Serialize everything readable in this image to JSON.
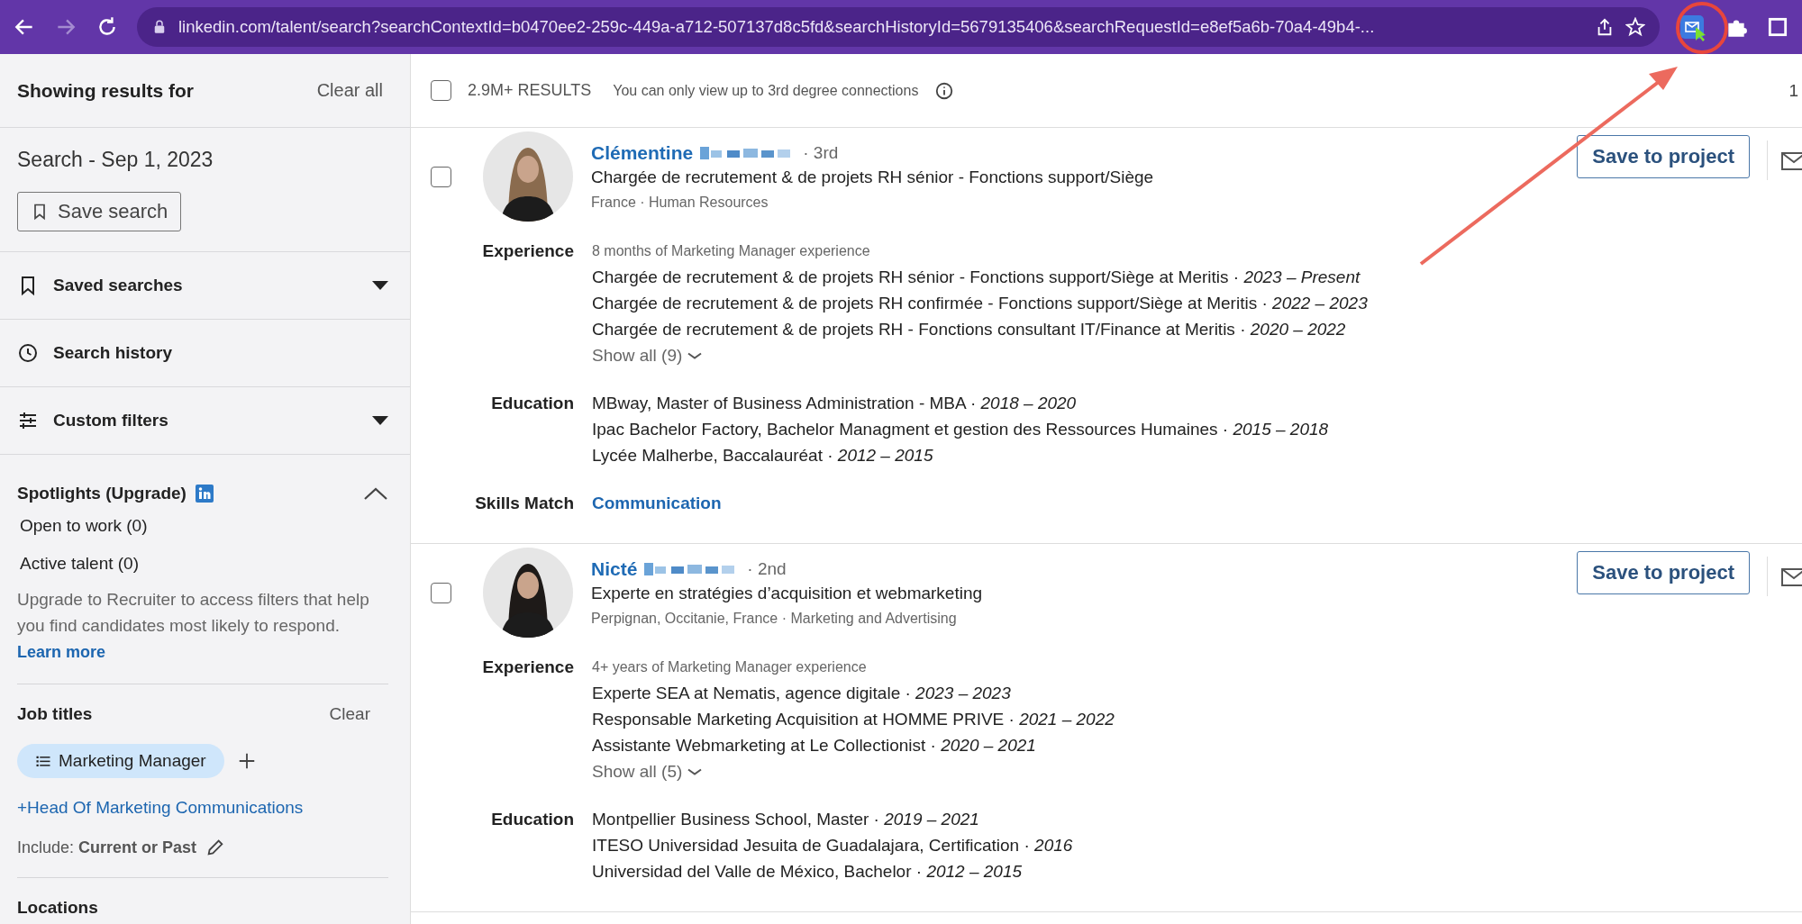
{
  "browser": {
    "url": "linkedin.com/talent/search?searchContextId=b0470ee2-259c-449a-a712-507137d8c5fd&searchHistoryId=5679135406&searchRequestId=e8ef5a6b-70a4-49b4-..."
  },
  "sidebar": {
    "title": "Showing results for",
    "clear_all": "Clear all",
    "search_name": "Search - Sep 1, 2023",
    "save_search": "Save search",
    "sections": [
      {
        "label": "Saved searches",
        "kind": "dropdown"
      },
      {
        "label": "Search history",
        "kind": "link"
      },
      {
        "label": "Custom filters",
        "kind": "dropdown"
      }
    ],
    "spotlights": {
      "title": "Spotlights (Upgrade)",
      "expanded": true,
      "items": [
        "Open to work (0)",
        "Active talent (0)"
      ],
      "description": "Upgrade to Recruiter to access filters that help you find candidates most likely to respond.",
      "learn_more": "Learn more"
    },
    "job_titles": {
      "title": "Job titles",
      "clear": "Clear",
      "chips": [
        "Marketing Manager"
      ],
      "suggestions": [
        "+Head Of Marketing Communications"
      ],
      "include": "Include: **Current or Past**"
    },
    "next_section": "Locations"
  },
  "results": {
    "checked": false,
    "count": "2.9M+ RESULTS",
    "note": "You can only view up to 3rd degree connections",
    "page_edge": "1"
  },
  "candidates": [
    {
      "name": "Clémentine",
      "degree": "· 3rd",
      "checked": false,
      "headline": "Chargée de recrutement & de projets RH sénior - Fonctions support/Siège",
      "meta": "France · Human Resources",
      "save": "Save to project",
      "sections": [
        {
          "label": "Experience",
          "summary": "8 months of Marketing Manager experience",
          "lines": [
            "Chargée de recrutement & de projets RH sénior - Fonctions support/Siège at Meritis · *2023 – Present*",
            "Chargée de recrutement & de projets RH confirmée - Fonctions support/Siège at Meritis · *2022 – 2023*",
            "Chargée de recrutement & de projets RH - Fonctions consultant IT/Finance at Meritis · *2020 – 2022*"
          ],
          "show_all": "Show all (9)"
        },
        {
          "label": "Education",
          "lines": [
            "MBway, Master of Business Administration - MBA · *2018 – 2020*",
            "Ipac Bachelor Factory, Bachelor Managment et gestion des Ressources Humaines · *2015 – 2018*",
            "Lycée Malherbe, Baccalauréat · *2012 – 2015*"
          ]
        },
        {
          "label": "Skills Match",
          "skills": [
            "Communication"
          ]
        }
      ]
    },
    {
      "name": "Nicté",
      "degree": "· 2nd",
      "checked": false,
      "headline": "Experte en stratégies d’acquisition et webmarketing",
      "meta": "Perpignan, Occitanie, France · Marketing and Advertising",
      "save": "Save to project",
      "sections": [
        {
          "label": "Experience",
          "summary": "4+ years of Marketing Manager experience",
          "lines": [
            "Experte SEA at Nematis, agence digitale · *2023 – 2023*",
            "Responsable Marketing Acquisition at HOMME PRIVE · *2021 – 2022*",
            "Assistante Webmarketing at Le Collectionist · *2020 – 2021*"
          ],
          "show_all": "Show all (5)"
        },
        {
          "label": "Education",
          "lines": [
            "Montpellier Business School, Master · *2019 – 2021*",
            "ITESO Universidad Jesuita de Guadalajara, Certification · *2016*",
            "Universidad del Valle de México, Bachelor · *2012 – 2015*"
          ]
        }
      ]
    }
  ]
}
